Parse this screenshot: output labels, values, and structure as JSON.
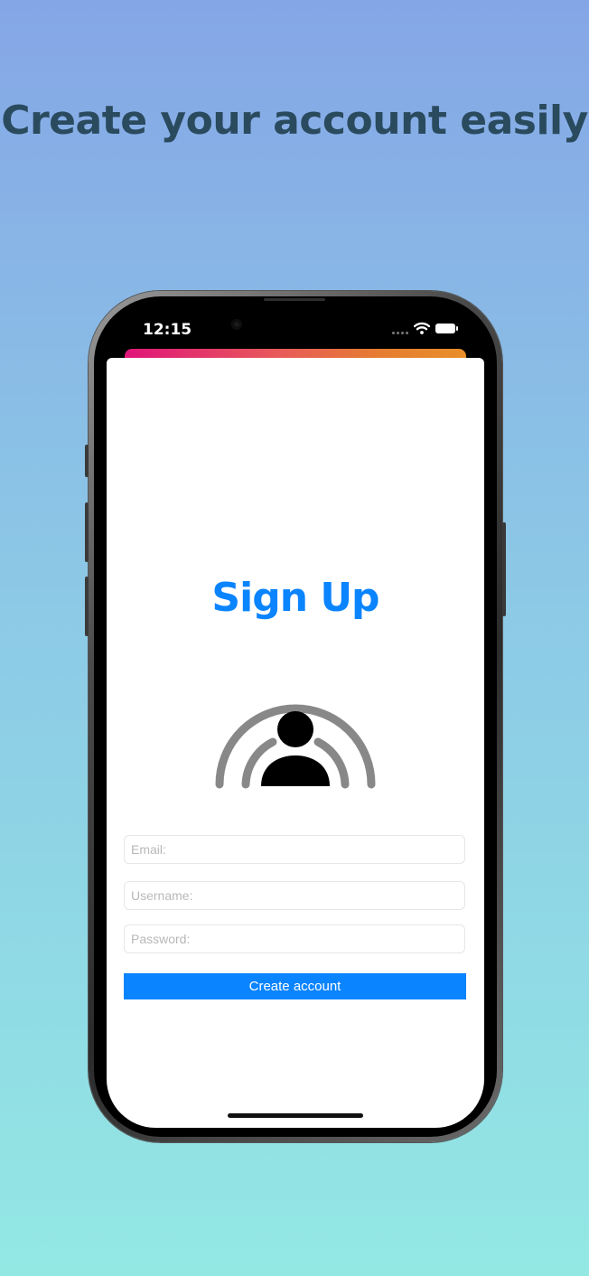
{
  "headline": "Create your account easily",
  "status_bar": {
    "time": "12:15"
  },
  "screen": {
    "title": "Sign Up",
    "icon": "person-signal-icon",
    "form": {
      "email_placeholder": "Email:",
      "username_placeholder": "Username:",
      "password_placeholder": "Password:",
      "submit_label": "Create account"
    }
  },
  "colors": {
    "accent": "#0a84ff",
    "headline": "#2a4a5e",
    "strip_start": "#e0157a",
    "strip_end": "#e88f2a"
  }
}
